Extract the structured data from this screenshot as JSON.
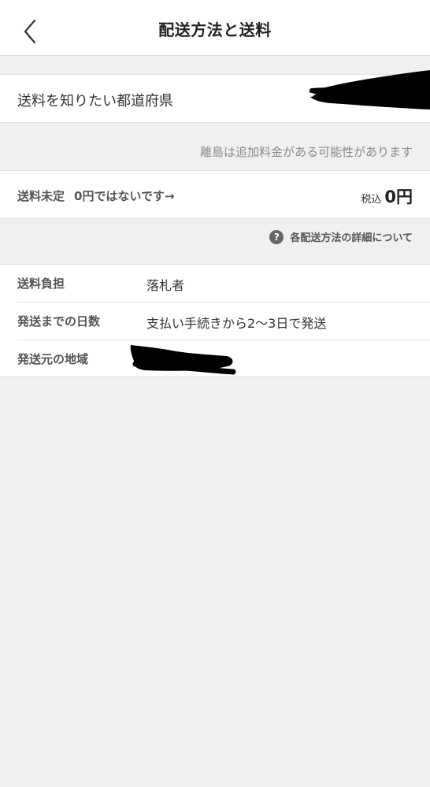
{
  "header": {
    "title": "配送方法と送料",
    "back_icon": "chevron-left-icon"
  },
  "prefecture": {
    "label": "送料を知りたい都道府県",
    "value_redacted": true
  },
  "note": "離島は追加料金がある可能性があります",
  "fee": {
    "status": "送料未定",
    "comment": "0円ではないです→",
    "tax_label": "税込",
    "amount": "0円"
  },
  "detail_link": {
    "icon": "question-circle-icon",
    "label": "各配送方法の詳細について"
  },
  "info": [
    {
      "label": "送料負担",
      "value": "落札者"
    },
    {
      "label": "発送までの日数",
      "value": "支払い手続きから2〜3日で発送"
    },
    {
      "label": "発送元の地域",
      "value": ""
    }
  ],
  "colors": {
    "background": "#f0f0f0",
    "card": "#ffffff",
    "redaction": "#000000"
  }
}
